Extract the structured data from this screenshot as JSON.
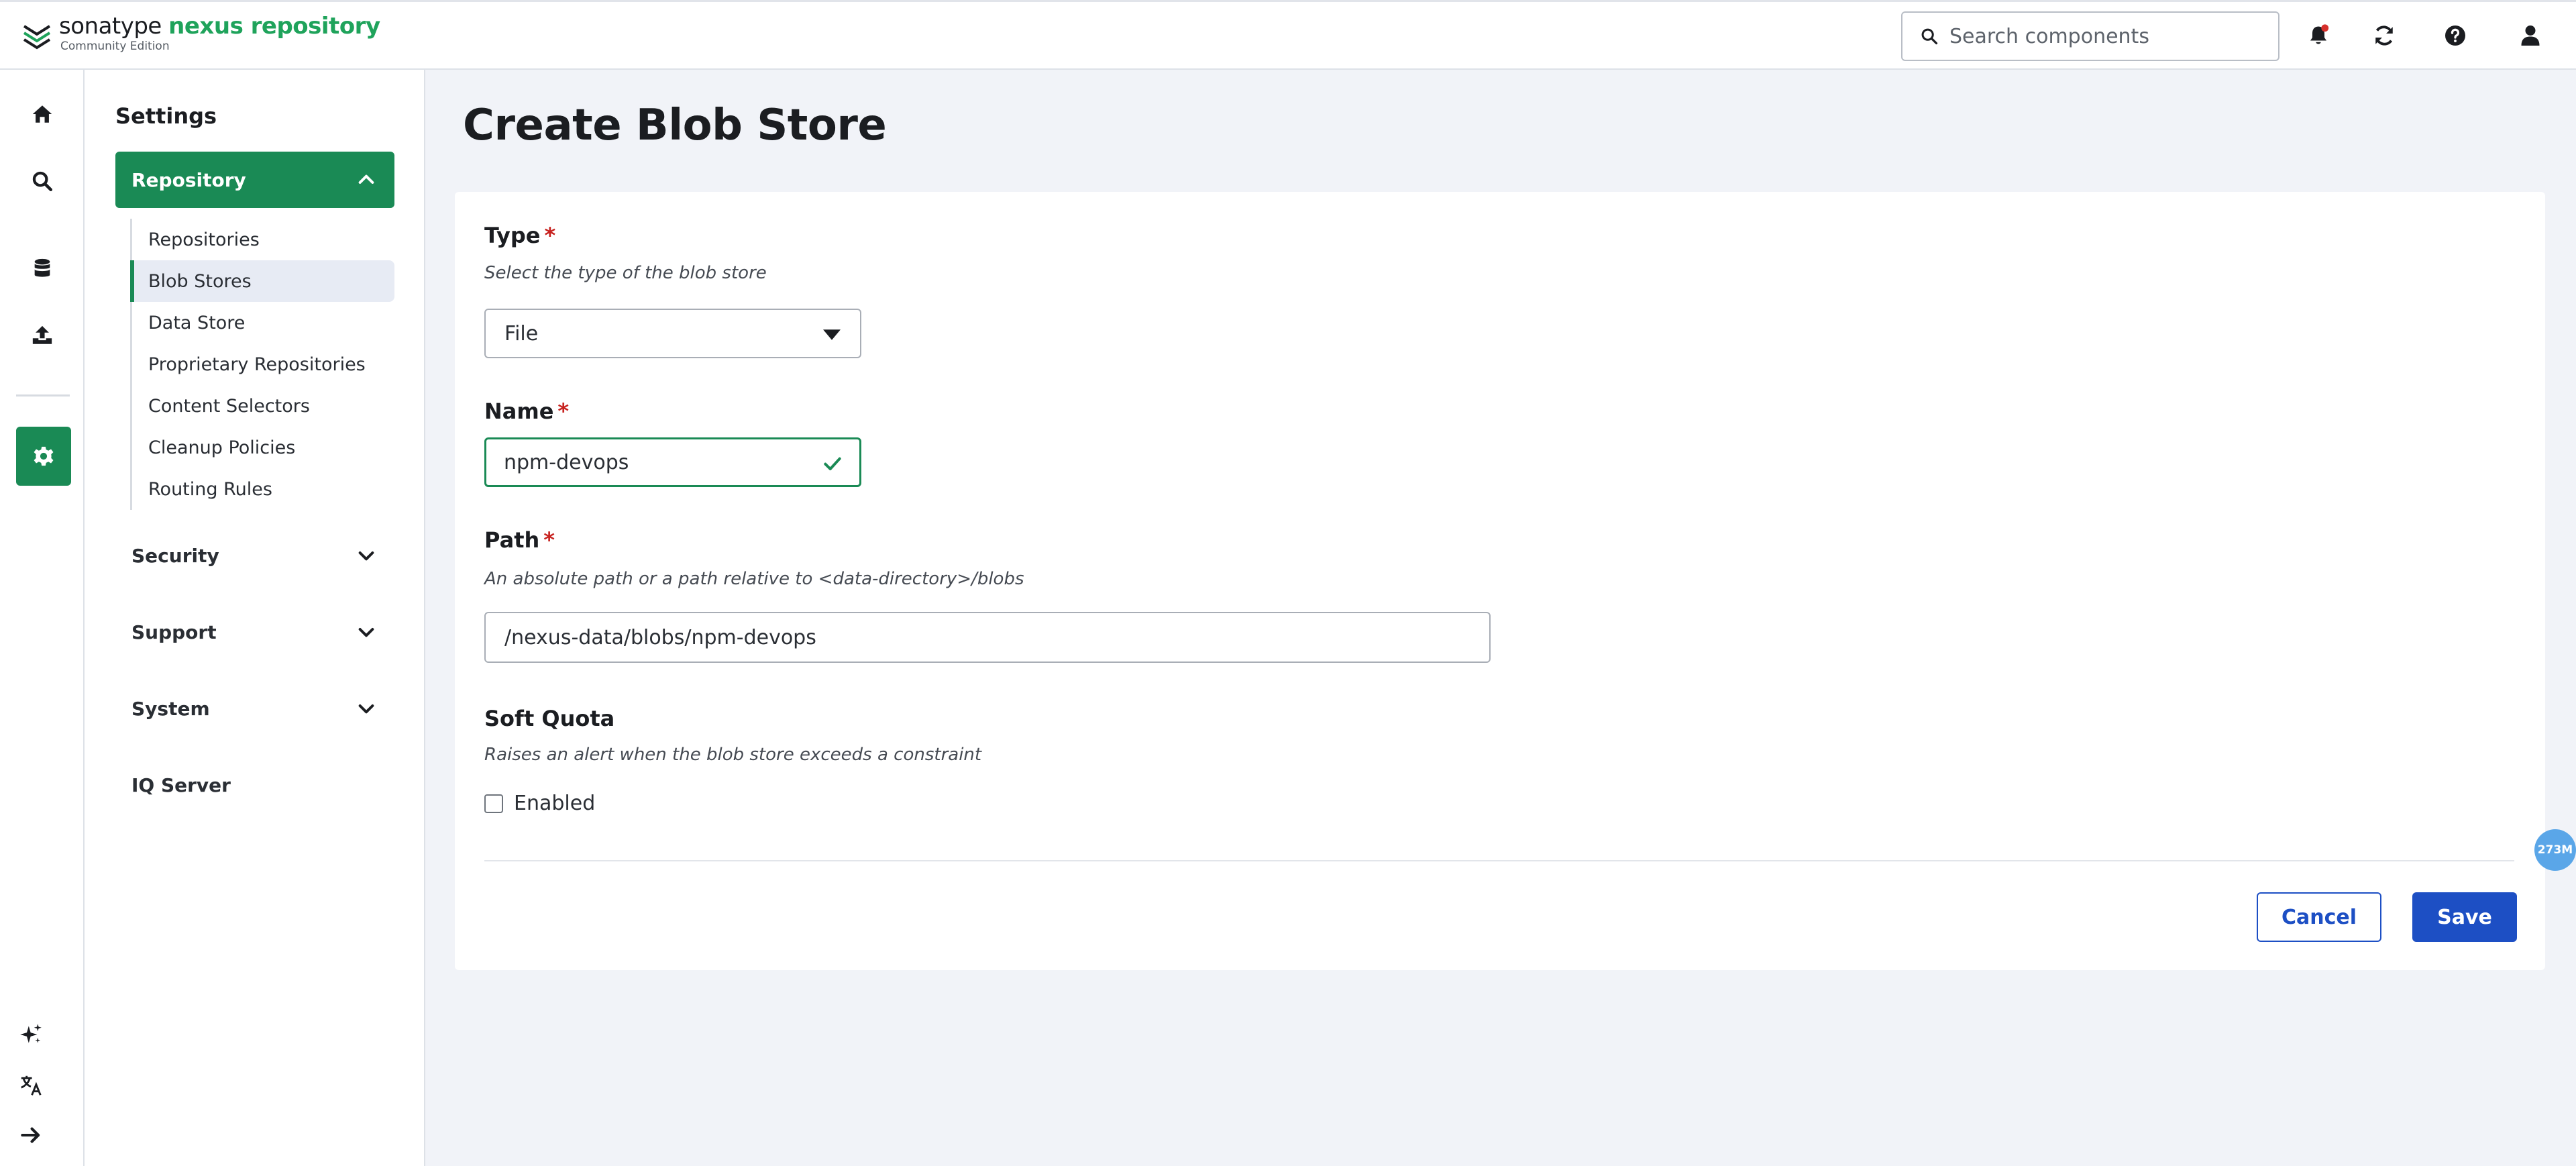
{
  "app": {
    "brand_part1": "sonatype",
    "brand_part2": "nexus repository",
    "edition": "Community Edition"
  },
  "header": {
    "search_placeholder": "Search components",
    "icons": [
      "bell-icon",
      "refresh-icon",
      "help-icon",
      "user-icon"
    ],
    "notification_dot_color": "#d6302b"
  },
  "rail": {
    "items": [
      "home-icon",
      "search-icon",
      "database-icon",
      "upload-icon",
      "settings-icon"
    ],
    "bottom": [
      "sparkle-icon",
      "translate-icon",
      "expand-arrow-icon"
    ]
  },
  "sidenav": {
    "title": "Settings",
    "repository_label": "Repository",
    "repository_items": [
      {
        "label": "Repositories"
      },
      {
        "label": "Blob Stores",
        "active": true
      },
      {
        "label": "Data Store"
      },
      {
        "label": "Proprietary Repositories"
      },
      {
        "label": "Content Selectors"
      },
      {
        "label": "Cleanup Policies"
      },
      {
        "label": "Routing Rules"
      }
    ],
    "sections": [
      {
        "label": "Security"
      },
      {
        "label": "Support"
      },
      {
        "label": "System"
      }
    ],
    "iq_server": "IQ Server"
  },
  "page": {
    "title": "Create Blob Store"
  },
  "form": {
    "type": {
      "label": "Type",
      "required_mark": "*",
      "help": "Select the type of the blob store",
      "value": "File"
    },
    "name": {
      "label": "Name",
      "required_mark": "*",
      "value": "npm-devops"
    },
    "path": {
      "label": "Path",
      "required_mark": "*",
      "help": "An absolute path or a path relative to <data-directory>/blobs",
      "value": "/nexus-data/blobs/npm-devops"
    },
    "soft_quota": {
      "label": "Soft Quota",
      "help": "Raises an alert when the blob store exceeds a constraint",
      "enabled_label": "Enabled",
      "enabled": false
    },
    "cancel_label": "Cancel",
    "save_label": "Save"
  },
  "memory_badge": "273M",
  "colors": {
    "brand_green": "#1a8a55",
    "primary_blue": "#1d4fc4",
    "required_red": "#c7221f"
  }
}
